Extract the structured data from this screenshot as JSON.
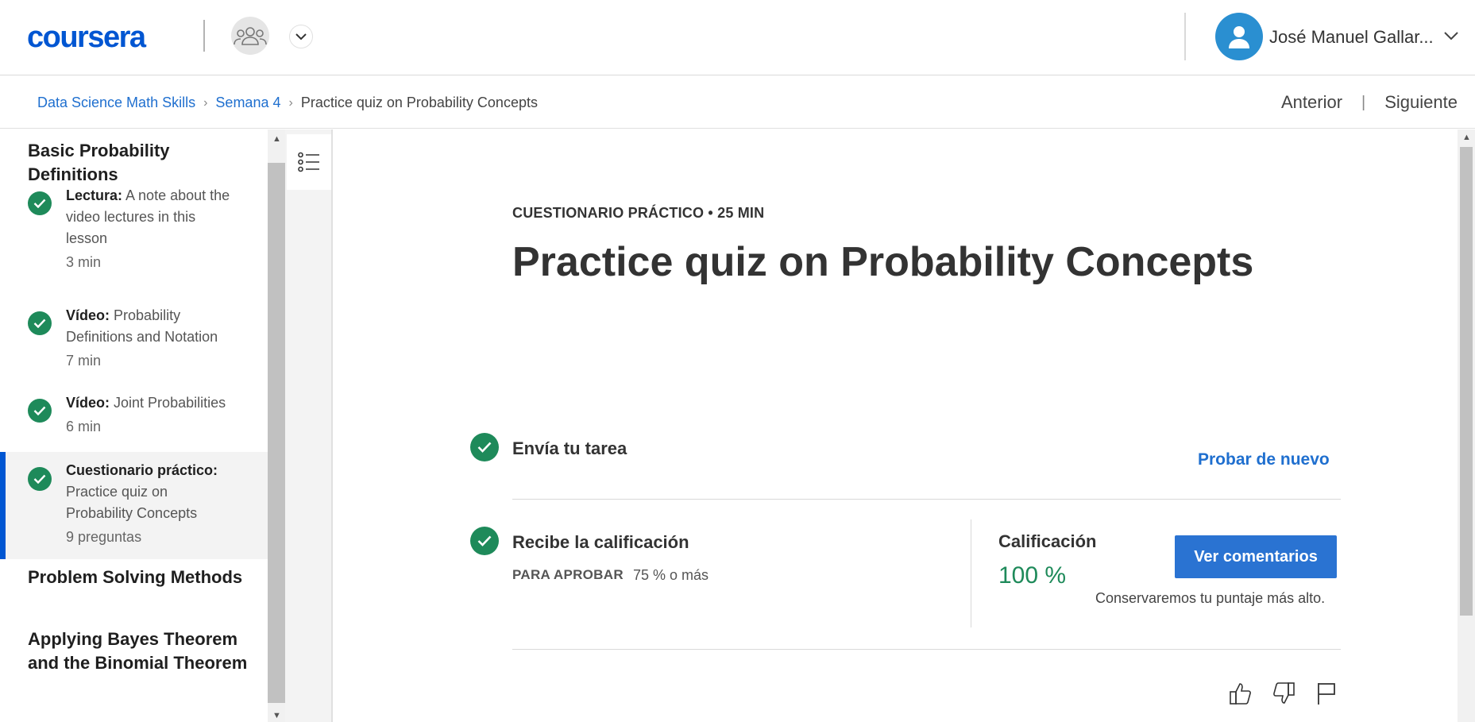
{
  "header": {
    "logo": "coursera",
    "user_name": "José Manuel Gallar...",
    "icons": [
      "group-icon",
      "chevron-down-icon",
      "user-icon",
      "chevron-down-icon"
    ]
  },
  "breadcrumb": {
    "items": [
      "Data Science Math Skills",
      "Semana 4"
    ],
    "current": "Practice quiz on Probability Concepts",
    "prev": "Anterior",
    "separator": "|",
    "next": "Siguiente"
  },
  "sidebar": {
    "section1": "Basic Probability Definitions",
    "items": [
      {
        "type": "Lectura:",
        "title": "A note about the video lectures in this lesson",
        "duration": "3 min"
      },
      {
        "type": "Vídeo:",
        "title": "Probability Definitions and Notation",
        "duration": "7 min"
      },
      {
        "type": "Vídeo:",
        "title": "Joint Probabilities",
        "duration": "6 min"
      },
      {
        "type": "Cuestionario práctico:",
        "title": "Practice quiz on Probability Concepts",
        "duration": "9 preguntas"
      }
    ],
    "section2": "Problem Solving Methods",
    "section3": "Applying Bayes Theorem and the Binomial Theorem"
  },
  "main": {
    "kicker": "CUESTIONARIO PRÁCTICO • 25 MIN",
    "title": "Practice quiz on Probability Concepts",
    "step1_label": "Envía tu tarea",
    "retry": "Probar de nuevo",
    "step2_label": "Recibe la calificación",
    "pass_label": "PARA APROBAR",
    "pass_value": "75 % o más",
    "grade_label": "Calificación",
    "grade_value": "100 %",
    "feedback_button": "Ver comentarios",
    "keep_note": "Conservaremos tu puntaje más alto."
  },
  "colors": {
    "brand": "#0056d2",
    "success": "#1e8a5a",
    "link": "#1f6fcf",
    "button": "#2a73d2"
  }
}
